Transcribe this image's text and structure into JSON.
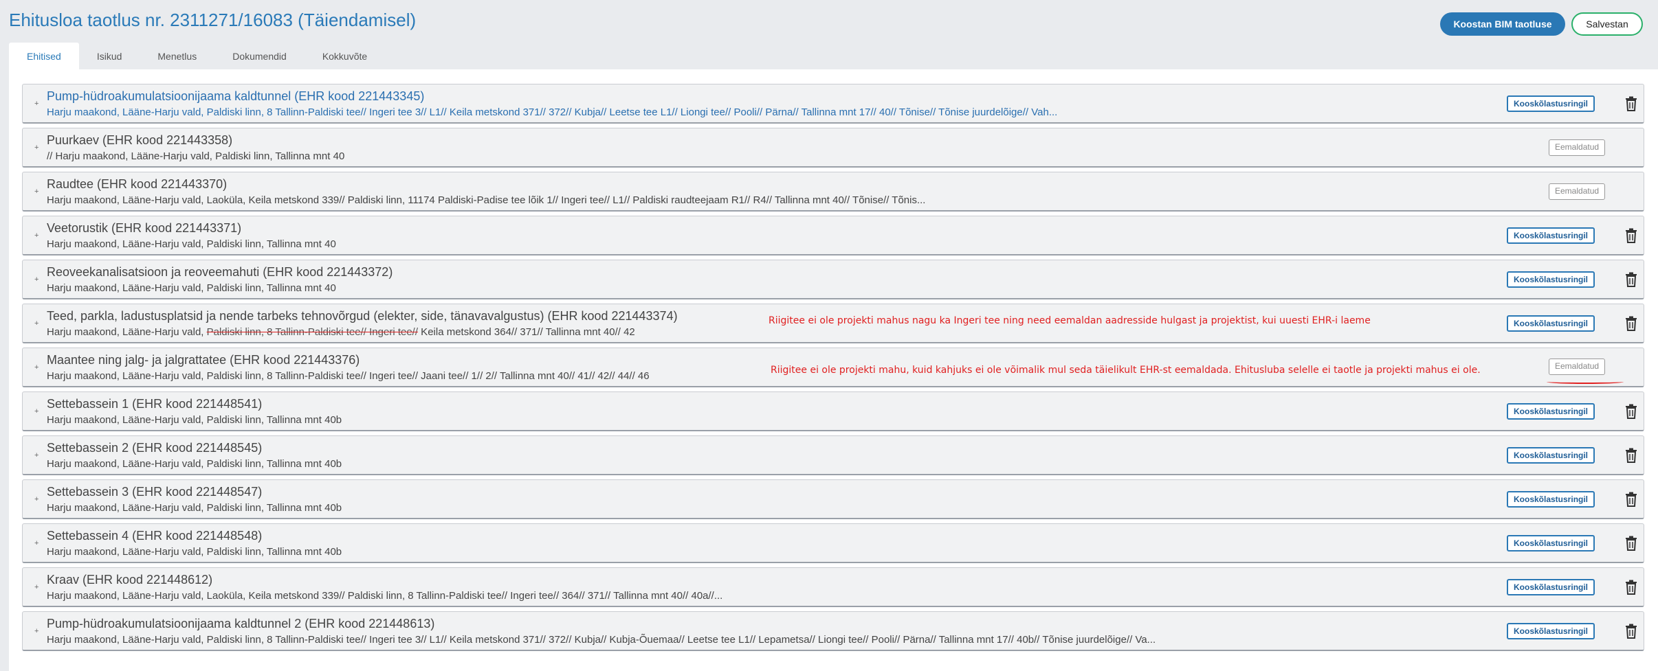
{
  "page": {
    "title": "Ehitusloa taotlus nr. 2311271/16083 (Täiendamisel)",
    "colors": {
      "primary": "#2a78b5",
      "save_border": "#2ab06a",
      "annotation": "#e02020"
    }
  },
  "header": {
    "bim_button": "Koostan BIM taotluse",
    "save_button": "Salvestan"
  },
  "tabs": [
    {
      "label": "Ehitised",
      "active": true
    },
    {
      "label": "Isikud",
      "active": false
    },
    {
      "label": "Menetlus",
      "active": false
    },
    {
      "label": "Dokumendid",
      "active": false
    },
    {
      "label": "Kokkuvõte",
      "active": false
    }
  ],
  "icons": {
    "expander": "plus-icon",
    "delete": "trash-icon"
  },
  "buildings": [
    {
      "title": "Pump-hüdroakumulatsioonijaama kaldtunnel (EHR kood 221443345)",
      "address": "Harju maakond, Lääne-Harju vald, Paldiski linn, 8 Tallinn-Paldiski tee// Ingeri tee 3// L1// Keila metskond 371// 372// Kubja// Leetse tee L1// Liongi tee// Pooli// Pärna// Tallinna mnt 17// 40// Tõnise// Tõnise juurdelõige// Vah...",
      "status": "Kooskõlastusringil",
      "deletable": true
    },
    {
      "title": "Puurkaev (EHR kood 221443358)",
      "address": "// Harju maakond, Lääne-Harju vald, Paldiski linn, Tallinna mnt 40",
      "status": "Eemaldatud",
      "deletable": false
    },
    {
      "title": "Raudtee (EHR kood 221443370)",
      "address": "Harju maakond, Lääne-Harju vald, Laoküla, Keila metskond 339// Paldiski linn, 11174 Paldiski-Padise tee lõik 1// Ingeri tee// L1// Paldiski raudteejaam R1// R4// Tallinna mnt 40// Tõnise// Tõnis...",
      "status": "Eemaldatud",
      "deletable": false
    },
    {
      "title": "Veetorustik (EHR kood 221443371)",
      "address": "Harju maakond, Lääne-Harju vald, Paldiski linn, Tallinna mnt 40",
      "status": "Kooskõlastusringil",
      "deletable": true
    },
    {
      "title": "Reoveekanalisatsioon ja reoveemahuti (EHR kood 221443372)",
      "address": "Harju maakond, Lääne-Harju vald, Paldiski linn, Tallinna mnt 40",
      "status": "Kooskõlastusringil",
      "deletable": true
    },
    {
      "title": "Teed, parkla, ladustusplatsid ja nende tarbeks tehnovõrgud (elekter, side, tänavavalgustus) (EHR kood 221443374)",
      "address_prefix": "Harju maakond, Lääne-Harju vald, ",
      "address_struck": "Paldiski linn, 8 Tallinn-Paldiski tee// Ingeri tee//",
      "address_suffix": " Keila metskond 364// 371// Tallinna mnt 40// 42",
      "annotation": "Riigitee ei ole projekti mahus nagu ka Ingeri tee ning need eemaldan aadresside hulgast ja projektist, kui uuesti EHR-i laeme",
      "status": "Kooskõlastusringil",
      "deletable": true
    },
    {
      "title": "Maantee ning jalg- ja jalgrattatee (EHR kood 221443376)",
      "address": "Harju maakond, Lääne-Harju vald, Paldiski linn, 8 Tallinn-Paldiski tee// Ingeri tee// Jaani tee// 1// 2// Tallinna mnt 40// 41// 42// 44// 46",
      "annotation": "Riigitee ei ole projekti mahu, kuid kahjuks ei ole võimalik mul seda täielikult EHR-st eemaldada. Ehitusluba selelle ei taotle  ja projekti mahus ei ole.",
      "status": "Eemaldatud",
      "deletable": false
    },
    {
      "title": "Settebassein 1 (EHR kood 221448541)",
      "address": "Harju maakond, Lääne-Harju vald, Paldiski linn, Tallinna mnt 40b",
      "status": "Kooskõlastusringil",
      "deletable": true
    },
    {
      "title": "Settebassein 2 (EHR kood 221448545)",
      "address": "Harju maakond, Lääne-Harju vald, Paldiski linn, Tallinna mnt 40b",
      "status": "Kooskõlastusringil",
      "deletable": true
    },
    {
      "title": "Settebassein 3 (EHR kood 221448547)",
      "address": "Harju maakond, Lääne-Harju vald, Paldiski linn, Tallinna mnt 40b",
      "status": "Kooskõlastusringil",
      "deletable": true
    },
    {
      "title": "Settebassein 4 (EHR kood 221448548)",
      "address": "Harju maakond, Lääne-Harju vald, Paldiski linn, Tallinna mnt 40b",
      "status": "Kooskõlastusringil",
      "deletable": true
    },
    {
      "title": "Kraav (EHR kood 221448612)",
      "address": "Harju maakond, Lääne-Harju vald, Laoküla, Keila metskond 339// Paldiski linn, 8 Tallinn-Paldiski tee// Ingeri tee// 364// 371// Tallinna mnt 40// 40a//...",
      "status": "Kooskõlastusringil",
      "deletable": true
    },
    {
      "title": "Pump-hüdroakumulatsioonijaama kaldtunnel 2 (EHR kood 221448613)",
      "address": "Harju maakond, Lääne-Harju vald, Paldiski linn, 8 Tallinn-Paldiski tee// Ingeri tee 3// L1// Keila metskond 371// 372// Kubja// Kubja-Õuemaa// Leetse tee L1// Lepametsa// Liongi tee// Pooli// Pärna// Tallinna mnt 17// 40b// Tõnise juurdelõige// Va...",
      "status": "Kooskõlastusringil",
      "deletable": true
    }
  ]
}
